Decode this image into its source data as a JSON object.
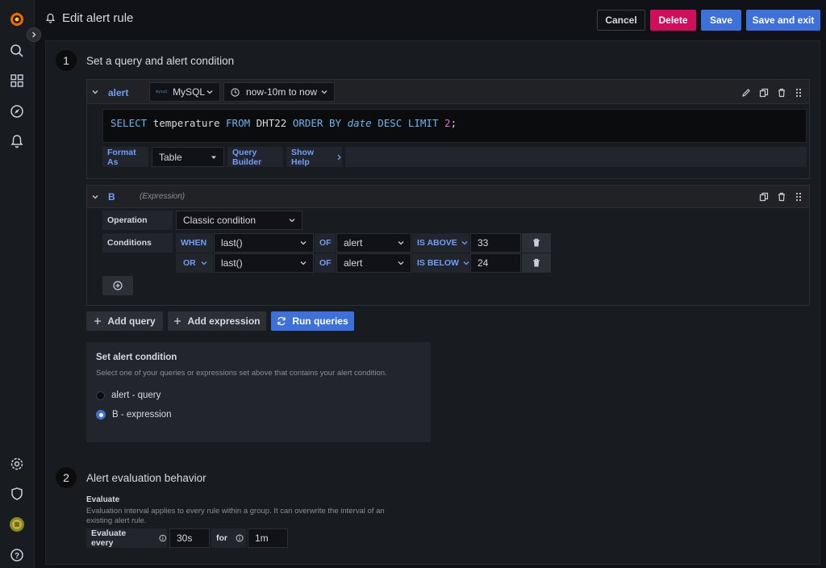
{
  "header": {
    "title": "Edit alert rule",
    "cancel_label": "Cancel",
    "delete_label": "Delete",
    "save_label": "Save",
    "save_exit_label": "Save and exit"
  },
  "colors": {
    "primary": "#3d71d9",
    "danger": "#d10e5c",
    "brand": "#f46800"
  },
  "step1": {
    "number": "1",
    "title": "Set a query and alert condition"
  },
  "query": {
    "name": "alert",
    "datasource": "MySQL",
    "datasource_logo_text": "mysql",
    "time_range": "now-10m to now",
    "sql": {
      "kw1": "SELECT",
      "col": "temperature",
      "kw2": "FROM",
      "table": "DHT22",
      "kw3": "ORDER BY",
      "order_col": "date",
      "kw4": "DESC",
      "kw5": "LIMIT",
      "limit": "2",
      "end": ";"
    },
    "format_as_label": "Format As",
    "format_value": "Table",
    "query_builder_label": "Query Builder",
    "show_help_label": "Show Help"
  },
  "expression": {
    "name": "B",
    "tag": "(Expression)",
    "operation_label": "Operation",
    "operation_value": "Classic condition",
    "conditions_label": "Conditions",
    "rows": [
      {
        "connector": "WHEN",
        "reducer": "last()",
        "of": "OF",
        "query": "alert",
        "evaluator": "IS ABOVE",
        "value": "33"
      },
      {
        "connector": "OR",
        "reducer": "last()",
        "of": "OF",
        "query": "alert",
        "evaluator": "IS BELOW",
        "value": "24"
      }
    ]
  },
  "actions": {
    "add_query": "Add query",
    "add_expression": "Add expression",
    "run_queries": "Run queries"
  },
  "condition_box": {
    "title": "Set alert condition",
    "description": "Select one of your queries or expressions set above that contains your alert condition.",
    "options": [
      {
        "label": "alert - query",
        "selected": false
      },
      {
        "label": "B - expression",
        "selected": true
      }
    ]
  },
  "step2": {
    "number": "2",
    "title": "Alert evaluation behavior",
    "evaluate_title": "Evaluate",
    "evaluate_desc_line1": "Evaluation interval applies to every rule within a group. It can overwrite the interval of an",
    "evaluate_desc_line2": "existing alert rule.",
    "evaluate_every_label": "Evaluate every",
    "evaluate_every_value": "30s",
    "for_label": "for",
    "for_value": "1m"
  }
}
